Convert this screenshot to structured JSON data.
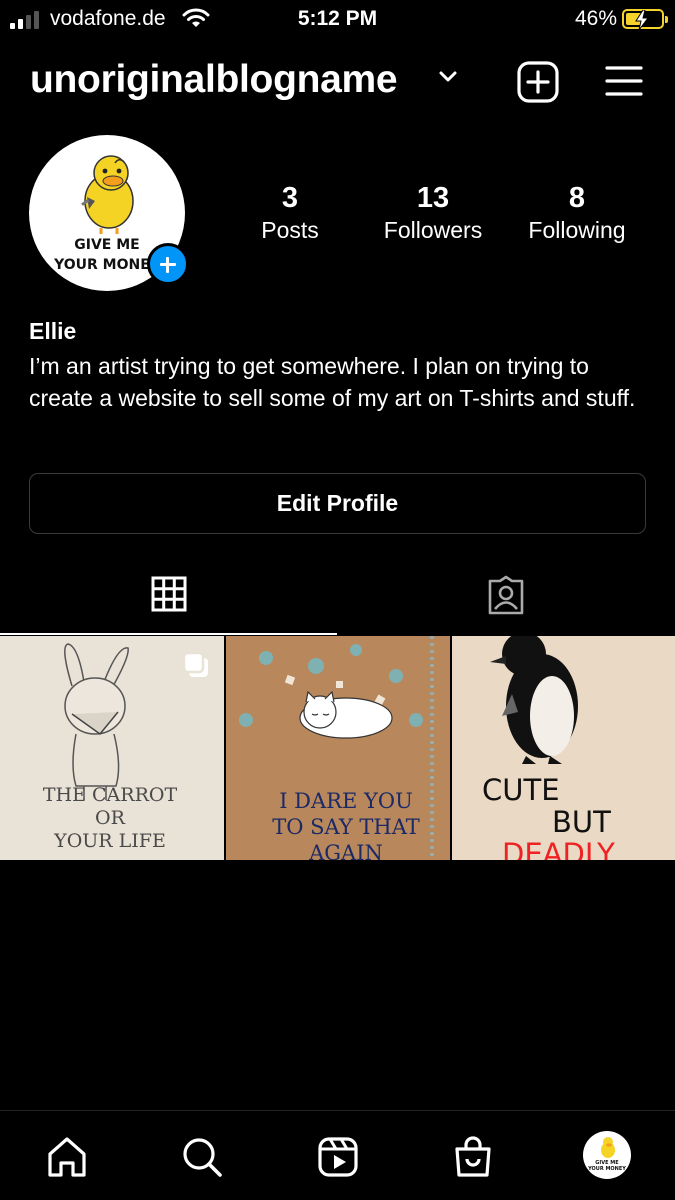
{
  "status_bar": {
    "carrier": "vodafone.de",
    "time": "5:12 PM",
    "battery_percent": "46%",
    "battery_level": 0.46,
    "signal_bars": 2,
    "icons": [
      "signal-icon",
      "wifi-icon",
      "battery-charging-icon"
    ]
  },
  "header": {
    "username": "unoriginalblogname",
    "icons": [
      "chevron-down-icon",
      "new-post-icon",
      "menu-icon"
    ]
  },
  "profile": {
    "avatar_text_line1": "GIVE ME",
    "avatar_text_line2": "YOUR MONEY",
    "stats": [
      {
        "value": "3",
        "label": "Posts"
      },
      {
        "value": "13",
        "label": "Followers"
      },
      {
        "value": "8",
        "label": "Following"
      }
    ],
    "display_name": "Ellie",
    "bio": "I’m an artist trying to get somewhere. I plan on trying to create a website to sell some of my art on T-shirts and stuff.",
    "edit_button": "Edit Profile"
  },
  "tabs": [
    {
      "name": "grid",
      "icon": "grid-icon",
      "active": true
    },
    {
      "name": "tagged",
      "icon": "tagged-person-icon",
      "active": false
    }
  ],
  "posts": [
    {
      "text_lines": [
        "THE CARROT",
        "OR",
        "YOUR LIFE"
      ],
      "multi": true
    },
    {
      "text_lines": [
        "I DARE YOU",
        "TO SAY THAT",
        "AGAIN"
      ],
      "multi": false
    },
    {
      "text_lines": [
        "CUTE",
        "BUT",
        "DEADLY"
      ],
      "multi": false
    }
  ],
  "bottom_nav": [
    "home-icon",
    "search-icon",
    "reels-icon",
    "shop-icon",
    "profile-avatar"
  ],
  "colors": {
    "background": "#000000",
    "accent_blue": "#0095f6",
    "battery_yellow": "#f5d22c",
    "button_border": "#3a3a3a"
  }
}
